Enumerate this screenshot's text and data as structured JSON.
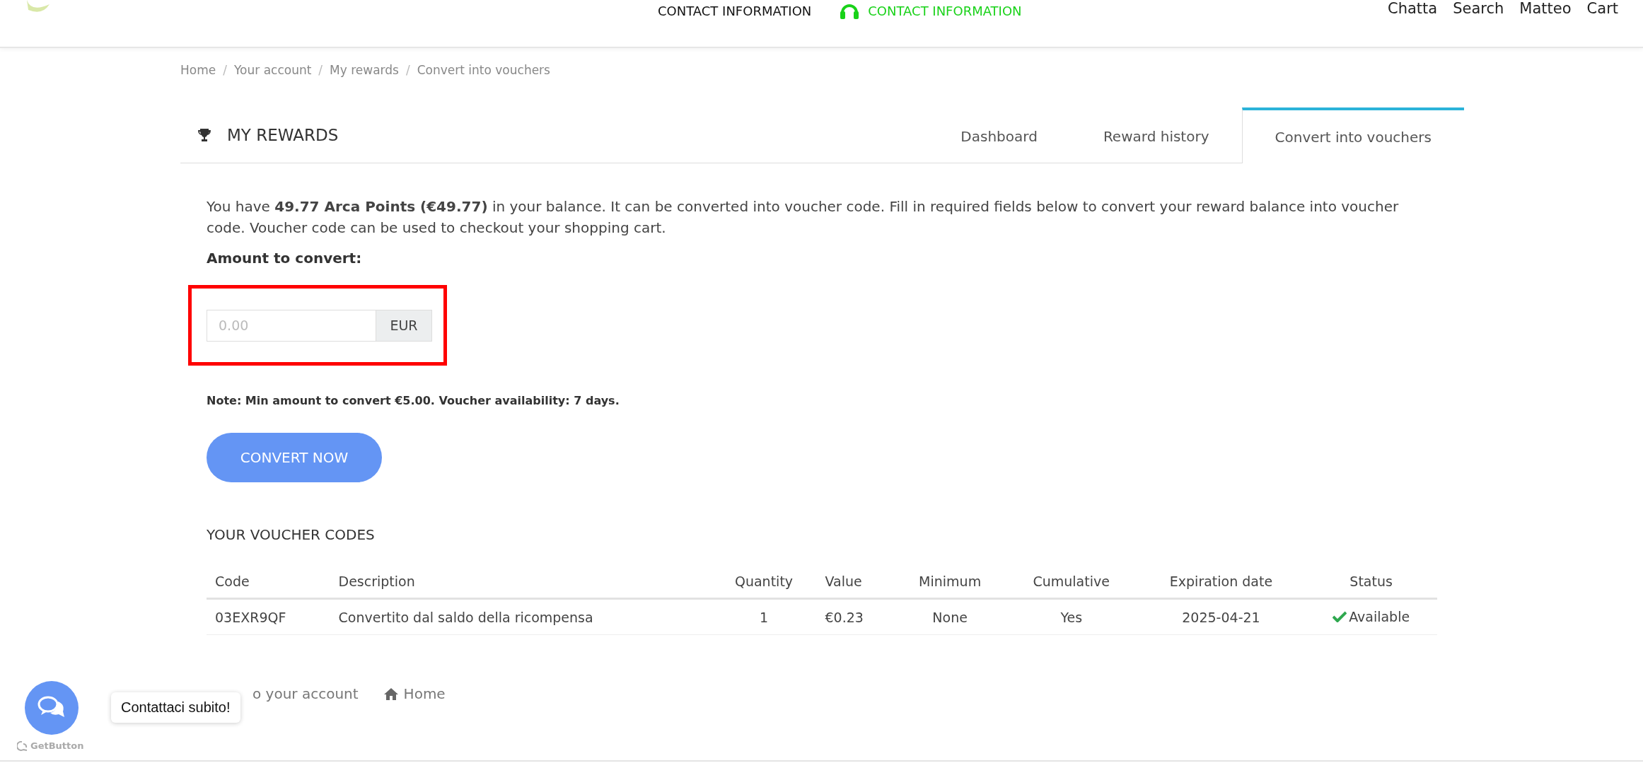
{
  "header": {
    "nav": [
      {
        "label": "CONTACT INFORMATION",
        "kind": "plain"
      },
      {
        "label": "CONTACT INFORMATION",
        "kind": "support"
      }
    ],
    "user_menu": [
      "Chatta",
      "Search",
      "Matteo",
      "Cart"
    ]
  },
  "breadcrumb": {
    "items": [
      "Home",
      "Your account",
      "My rewards",
      "Convert into vouchers"
    ],
    "separators": [
      "/",
      "/",
      "/"
    ]
  },
  "section": {
    "title": "MY REWARDS"
  },
  "tabs": [
    {
      "label": "Dashboard",
      "selected": false
    },
    {
      "label": "Reward history",
      "selected": false
    },
    {
      "label": "Convert into vouchers",
      "selected": true
    }
  ],
  "intro": "You have **49.77 Arca Points (€49.77)** in your balance. It can be converted into voucher code. Fill in required fields below to convert your reward balance into voucher code. Voucher code can be used to checkout your shopping cart.",
  "amount": {
    "label": "Amount to convert:",
    "placeholder": "0.00",
    "currency": "EUR",
    "highlighted": true
  },
  "note": "Note: Min amount to convert €5.00. Voucher availability: 7 days.",
  "convert_button": "CONVERT NOW",
  "vouchers": {
    "title": "YOUR VOUCHER CODES",
    "columns": [
      "Code",
      "Description",
      "Quantity",
      "Value",
      "Minimum",
      "Cumulative",
      "Expiration date",
      "Status"
    ],
    "rows": [
      {
        "cells": [
          "03EXR9QF",
          "Convertito dal saldo della ricompensa",
          "1",
          "€0.23",
          "None",
          "Yes",
          "2025-04-21"
        ],
        "status": {
          "label": "Available",
          "kind": "available"
        }
      }
    ]
  },
  "footer_links": [
    {
      "label": "o your account",
      "kind": "plain"
    },
    {
      "label": "Home",
      "kind": "home"
    }
  ],
  "chat_widget": {
    "tooltip": "Contattaci subito!",
    "brand": "GetButton"
  }
}
